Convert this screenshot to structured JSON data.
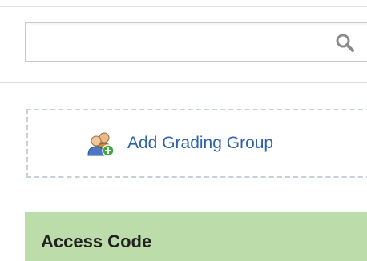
{
  "search": {
    "value": "",
    "placeholder": "",
    "icon": "search-icon"
  },
  "add_group": {
    "label": "Add Grading Group",
    "icon": "add-group-icon"
  },
  "section": {
    "title": "Access Code"
  },
  "colors": {
    "link_blue": "#2e63a8",
    "header_green": "#bcdcaa",
    "dashed_border": "#c7cfdb"
  }
}
